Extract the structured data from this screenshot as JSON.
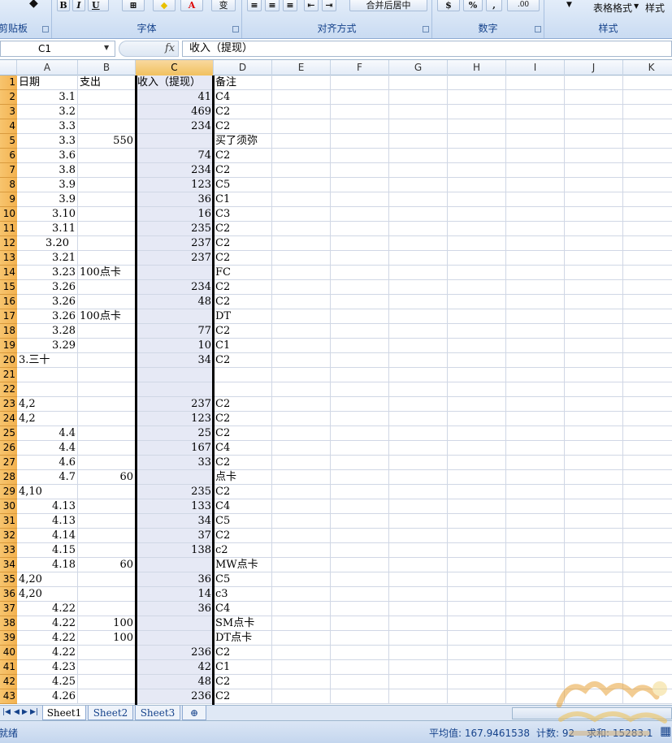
{
  "ribbon": {
    "groups": [
      {
        "label": "剪贴板"
      },
      {
        "label": "字体"
      },
      {
        "label": "对齐方式"
      },
      {
        "label": "数字"
      },
      {
        "label": "样式"
      }
    ],
    "merge_label": "合并后居中",
    "table_format_label": "表格格式",
    "style_label": "样式",
    "bold": "B",
    "italic": "I",
    "underline": "U",
    "font_color_letter": "A",
    "phonetic": "变",
    "percent": "%",
    "comma": ",",
    "decimal_inc": ".00"
  },
  "formula_bar": {
    "name_box": "C1",
    "fx": "fx",
    "value": "收入（提现）"
  },
  "columns": [
    "A",
    "B",
    "C",
    "D",
    "E",
    "F",
    "G",
    "H",
    "I",
    "J",
    "K"
  ],
  "selected_column": "C",
  "rows": [
    {
      "n": "1",
      "a": "日期",
      "b": "支出",
      "c": "收入（提现）",
      "d": "备注",
      "a_num": false
    },
    {
      "n": "2",
      "a": "3.1",
      "b": "",
      "c": "41",
      "d": "C4",
      "a_num": true
    },
    {
      "n": "3",
      "a": "3.2",
      "b": "",
      "c": "469",
      "d": "C2",
      "a_num": true
    },
    {
      "n": "4",
      "a": "3.3",
      "b": "",
      "c": "234",
      "d": "C2",
      "a_num": true
    },
    {
      "n": "5",
      "a": "3.3",
      "b": "550",
      "c": "",
      "d": "买了须弥",
      "a_num": true
    },
    {
      "n": "6",
      "a": "3.6",
      "b": "",
      "c": "74",
      "d": "C2",
      "a_num": true
    },
    {
      "n": "7",
      "a": "3.8",
      "b": "",
      "c": "234",
      "d": "C2",
      "a_num": true
    },
    {
      "n": "8",
      "a": "3.9",
      "b": "",
      "c": "123",
      "d": "C5",
      "a_num": true
    },
    {
      "n": "9",
      "a": "3.9",
      "b": "",
      "c": "36",
      "d": "C1",
      "a_num": true
    },
    {
      "n": "10",
      "a": "3.10",
      "b": "",
      "c": "16",
      "d": "C3",
      "a_num": true
    },
    {
      "n": "11",
      "a": "3.11",
      "b": "",
      "c": "235",
      "d": "C2",
      "a_num": true
    },
    {
      "n": "12",
      "a": "3.20",
      "b": "",
      "c": "237",
      "d": "C2",
      "a_num": true,
      "a_indent": true
    },
    {
      "n": "13",
      "a": "3.21",
      "b": "",
      "c": "237",
      "d": "C2",
      "a_num": true
    },
    {
      "n": "14",
      "a": "3.23",
      "b": "100点卡",
      "c": "",
      "d": "FC",
      "a_num": true
    },
    {
      "n": "15",
      "a": "3.26",
      "b": "",
      "c": "234",
      "d": "C2",
      "a_num": true
    },
    {
      "n": "16",
      "a": "3.26",
      "b": "",
      "c": "48",
      "d": "C2",
      "a_num": true
    },
    {
      "n": "17",
      "a": "3.26",
      "b": "100点卡",
      "c": "",
      "d": "DT",
      "a_num": true
    },
    {
      "n": "18",
      "a": "3.28",
      "b": "",
      "c": "77",
      "d": "C2",
      "a_num": true
    },
    {
      "n": "19",
      "a": "3.29",
      "b": "",
      "c": "10",
      "d": "C1",
      "a_num": true
    },
    {
      "n": "20",
      "a": "3.三十",
      "b": "",
      "c": "34",
      "d": "C2",
      "a_num": false
    },
    {
      "n": "21",
      "a": "",
      "b": "",
      "c": "",
      "d": "",
      "a_num": false
    },
    {
      "n": "22",
      "a": "",
      "b": "",
      "c": "",
      "d": "",
      "a_num": false
    },
    {
      "n": "23",
      "a": "4,2",
      "b": "",
      "c": "237",
      "d": "C2",
      "a_num": false
    },
    {
      "n": "24",
      "a": "4,2",
      "b": "",
      "c": "123",
      "d": "C2",
      "a_num": false
    },
    {
      "n": "25",
      "a": "4.4",
      "b": "",
      "c": "25",
      "d": "C2",
      "a_num": true
    },
    {
      "n": "26",
      "a": "4.4",
      "b": "",
      "c": "167",
      "d": "C4",
      "a_num": true
    },
    {
      "n": "27",
      "a": "4.6",
      "b": "",
      "c": "33",
      "d": "C2",
      "a_num": true
    },
    {
      "n": "28",
      "a": "4.7",
      "b": "60",
      "c": "",
      "d": "点卡",
      "a_num": true
    },
    {
      "n": "29",
      "a": "4,10",
      "b": "",
      "c": "235",
      "d": "C2",
      "a_num": false
    },
    {
      "n": "30",
      "a": "4.13",
      "b": "",
      "c": "133",
      "d": "C4",
      "a_num": true
    },
    {
      "n": "31",
      "a": "4.13",
      "b": "",
      "c": "34",
      "d": "C5",
      "a_num": true
    },
    {
      "n": "32",
      "a": "4.14",
      "b": "",
      "c": "37",
      "d": "C2",
      "a_num": true
    },
    {
      "n": "33",
      "a": "4.15",
      "b": "",
      "c": "138",
      "d": "c2",
      "a_num": true
    },
    {
      "n": "34",
      "a": "4.18",
      "b": "60",
      "c": "",
      "d": "MW点卡",
      "a_num": true
    },
    {
      "n": "35",
      "a": "4,20",
      "b": "",
      "c": "36",
      "d": "C5",
      "a_num": false
    },
    {
      "n": "36",
      "a": "4,20",
      "b": "",
      "c": "14",
      "d": "c3",
      "a_num": false
    },
    {
      "n": "37",
      "a": "4.22",
      "b": "",
      "c": "36",
      "d": "C4",
      "a_num": true
    },
    {
      "n": "38",
      "a": "4.22",
      "b": "100",
      "c": "",
      "d": "SM点卡",
      "a_num": true
    },
    {
      "n": "39",
      "a": "4.22",
      "b": "100",
      "c": "",
      "d": "DT点卡",
      "a_num": true
    },
    {
      "n": "40",
      "a": "4.22",
      "b": "",
      "c": "236",
      "d": "C2",
      "a_num": true
    },
    {
      "n": "41",
      "a": "4.23",
      "b": "",
      "c": "42",
      "d": "C1",
      "a_num": true
    },
    {
      "n": "42",
      "a": "4.25",
      "b": "",
      "c": "48",
      "d": "C2",
      "a_num": true
    },
    {
      "n": "43",
      "a": "4.26",
      "b": "",
      "c": "236",
      "d": "C2",
      "a_num": true
    }
  ],
  "sheets": [
    "Sheet1",
    "Sheet2",
    "Sheet3"
  ],
  "active_sheet": "Sheet1",
  "status": {
    "ready": "就绪",
    "average": "平均值: 167.9461538",
    "count": "计数: 92",
    "sum": "求和: 15283.1"
  },
  "colors": {
    "row_header": "#f3b24f",
    "selected_col_fill": "#e6e9f5",
    "ribbon_text": "#15428b"
  }
}
